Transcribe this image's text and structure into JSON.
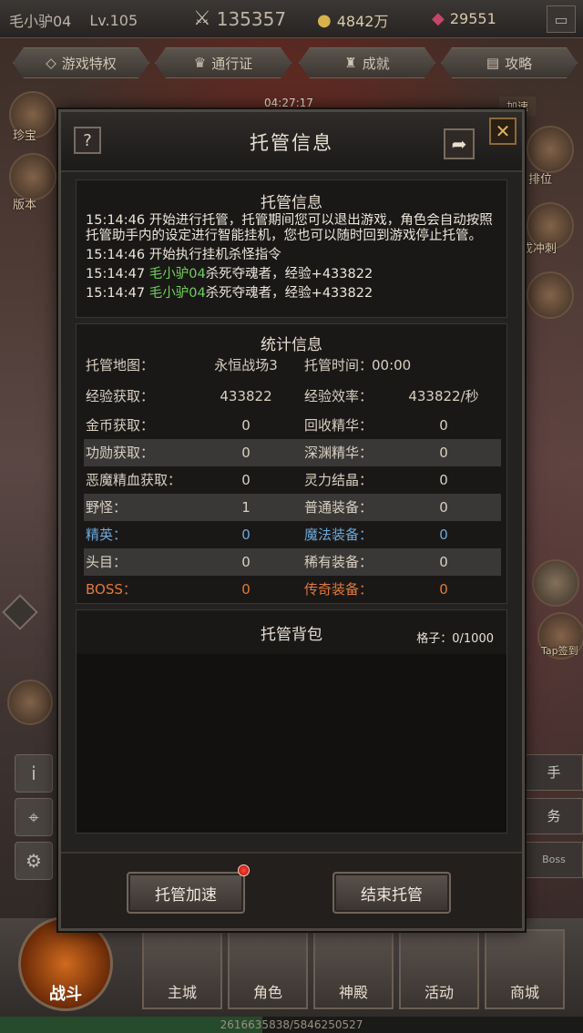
{
  "topbar": {
    "player_name": "毛小驴04",
    "level": "Lv.105",
    "power": "135357",
    "gold": "4842万",
    "gems": "29551"
  },
  "nav": [
    "游戏特权",
    "通行证",
    "成就",
    "攻略"
  ],
  "timer": "04:27:17",
  "side_labels": {
    "left_1": "珍宝",
    "left_2": "版本",
    "right_1": "排位",
    "right_2": "成冲刺",
    "right_3": "Tap签到",
    "accelerate": "加速",
    "right_panel_1": "手",
    "right_panel_2": "务",
    "right_panel_3": "Boss"
  },
  "dialog": {
    "title": "托管信息",
    "help": "?",
    "log_panel": {
      "title": "托管信息",
      "entries": [
        {
          "time": "15:14:46",
          "text": "开始进行托管，托管期间您可以退出游戏，角色会自动按照托管助手内的设定进行智能挂机，您也可以随时回到游戏停止托管。"
        },
        {
          "time": "15:14:46",
          "text": "开始执行挂机杀怪指令"
        },
        {
          "time": "15:14:47",
          "name": "毛小驴04",
          "text": "杀死夺魂者，经验+433822"
        },
        {
          "time": "15:14:47",
          "name": "毛小驴04",
          "text": "杀死夺魂者，经验+433822"
        }
      ]
    },
    "stats_panel": {
      "title": "统计信息",
      "rows": [
        {
          "k1": "托管地图：",
          "v1": "永恒战场3",
          "k2": "托管时间：",
          "v2": "00:00"
        },
        {
          "k1": "经验获取：",
          "v1": "433822",
          "k2": "经验效率：",
          "v2": "433822/秒"
        },
        {
          "k1": "金币获取：",
          "v1": "0",
          "k2": "回收精华：",
          "v2": "0"
        },
        {
          "k1": "功勋获取：",
          "v1": "0",
          "k2": "深渊精华：",
          "v2": "0"
        },
        {
          "k1": "恶魔精血获取：",
          "v1": "0",
          "k2": "灵力结晶：",
          "v2": "0"
        },
        {
          "k1": "野怪：",
          "v1": "1",
          "k2": "普通装备：",
          "v2": "0"
        },
        {
          "k1": "精英：",
          "v1": "0",
          "k2": "魔法装备：",
          "v2": "0"
        },
        {
          "k1": "头目：",
          "v1": "0",
          "k2": "稀有装备：",
          "v2": "0"
        },
        {
          "k1": "BOSS：",
          "v1": "0",
          "k2": "传奇装备：",
          "v2": "0"
        }
      ]
    },
    "bag_panel": {
      "title": "托管背包",
      "slots": "格子：0/1000"
    },
    "buttons": {
      "accelerate": "托管加速",
      "end": "结束托管"
    }
  },
  "bottom_nav": {
    "fight": "战斗",
    "items": [
      "主城",
      "角色",
      "神殿",
      "活动",
      "商城"
    ]
  },
  "xp_bar": {
    "text": "2616635838/5846250527",
    "progress": 0.45
  },
  "colors": {
    "green_name": "#6fcf5a",
    "elite": "#6ca8d8",
    "boss": "#e07a3a",
    "magic_item": "#6ca8d8",
    "legend_item": "#e07a3a"
  }
}
